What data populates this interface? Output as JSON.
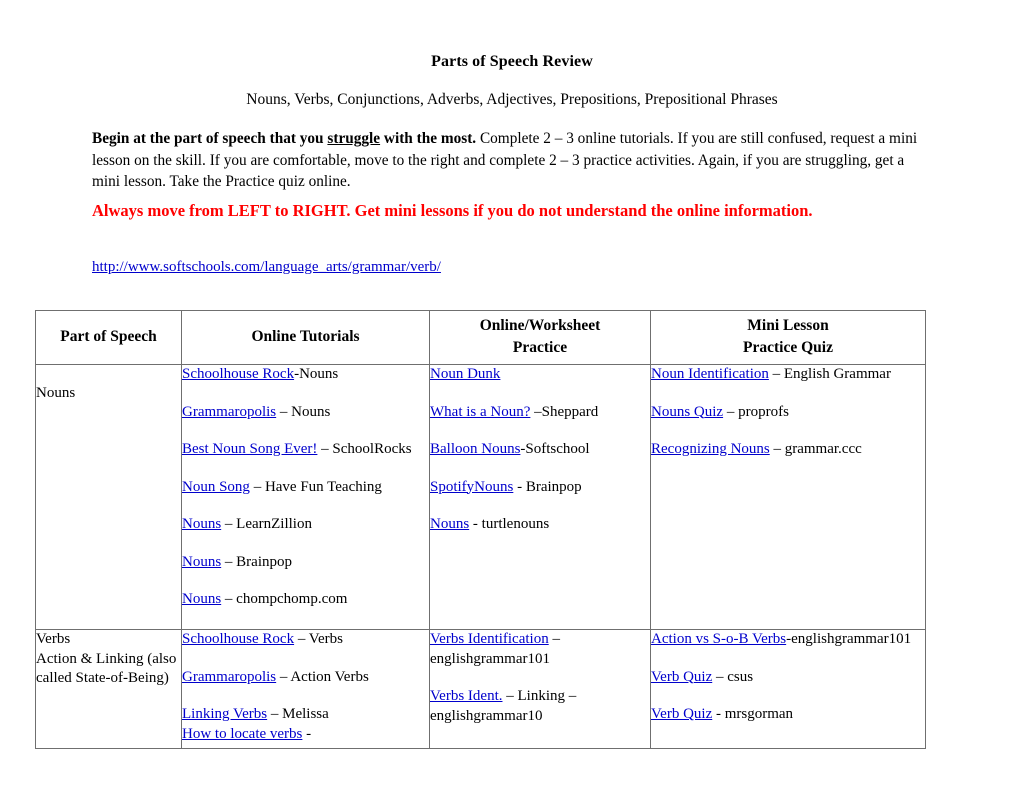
{
  "document": {
    "title": "Parts of Speech Review",
    "subtitle": "Nouns, Verbs, Conjunctions, Adverbs, Adjectives,  Prepositions, Prepositional Phrases",
    "intro": {
      "bold_lead": "Begin at the part of speech that you ",
      "bold_underline": "struggle",
      "bold_tail": " with the most.",
      "body": "  Complete 2 – 3 online tutorials.  If you are still confused, request a mini lesson on the skill.  If you are comfortable, move to the right and complete 2 – 3 practice activities.  Again, if you are struggling, get a mini lesson.  Take the Practice quiz online."
    },
    "warning": "Always move from LEFT to RIGHT.  Get mini lessons if you do not understand the online information.",
    "warning_color": "#ff0000",
    "link_color": "#0000cc",
    "url": "http://www.softschools.com/language_arts/grammar/verb/"
  },
  "table": {
    "headers": [
      "Part of Speech",
      "Online Tutorials",
      "Online/Worksheet\nPractice",
      "Mini Lesson\nPractice Quiz"
    ],
    "headers_split": {
      "h1": "Part of Speech",
      "h2": "Online Tutorials",
      "h3a": "Online/Worksheet",
      "h3b": "Practice",
      "h4a": "Mini Lesson",
      "h4b": "Practice Quiz"
    },
    "rows": [
      {
        "part_of_speech": "Nouns",
        "part_of_speech_extra": "",
        "tutorials": [
          {
            "link": "Schoolhouse Rock",
            "rest": "-Nouns"
          },
          {
            "link": "Grammaropolis",
            "rest": " – Nouns"
          },
          {
            "link": "Best Noun Song Ever!",
            "rest": " – SchoolRocks"
          },
          {
            "link": "Noun Song",
            "rest": " – Have Fun Teaching"
          },
          {
            "link": "Nouns",
            "rest": " – LearnZillion"
          },
          {
            "link": "Nouns",
            "rest": " – Brainpop"
          },
          {
            "link": "Nouns",
            "rest": " – chompchomp.com"
          }
        ],
        "practice": [
          {
            "link": "Noun Dunk",
            "rest": ""
          },
          {
            "link": "What is a Noun?",
            "rest": " –Sheppard"
          },
          {
            "link": "Balloon Nouns",
            "rest": "-Softschool"
          },
          {
            "link": "SpotifyNouns",
            "rest": " - Brainpop"
          },
          {
            "link": "Nouns",
            "rest": " - turtlenouns"
          }
        ],
        "minilesson": [
          {
            "link": "Noun Identification",
            "rest": " – English Grammar"
          },
          {
            "link": "Nouns Quiz",
            "rest": " – proprofs"
          },
          {
            "link": "Recognizing Nouns",
            "rest": " – grammar.ccc"
          }
        ]
      },
      {
        "part_of_speech": "Verbs",
        "part_of_speech_extra": "Action & Linking (also called State-of-Being)",
        "tutorials": [
          {
            "link": "Schoolhouse Rock",
            "rest": " – Verbs"
          },
          {
            "link": "Grammaropolis",
            "rest": " – Action Verbs"
          },
          {
            "link": "Linking Verbs",
            "rest": " – Melissa"
          },
          {
            "link": "How to locate verbs",
            "rest": " -"
          }
        ],
        "practice": [
          {
            "link": "Verbs Identification",
            "rest": " – englishgrammar101"
          },
          {
            "link": "Verbs Ident.",
            "rest": " – Linking – englishgrammar10"
          }
        ],
        "minilesson": [
          {
            "link": "Action vs S-o-B Verbs",
            "rest": "-englishgrammar101"
          },
          {
            "link": "Verb Quiz",
            "rest": " – csus"
          },
          {
            "link": "Verb Quiz",
            "rest": " - mrsgorman"
          }
        ]
      }
    ]
  }
}
